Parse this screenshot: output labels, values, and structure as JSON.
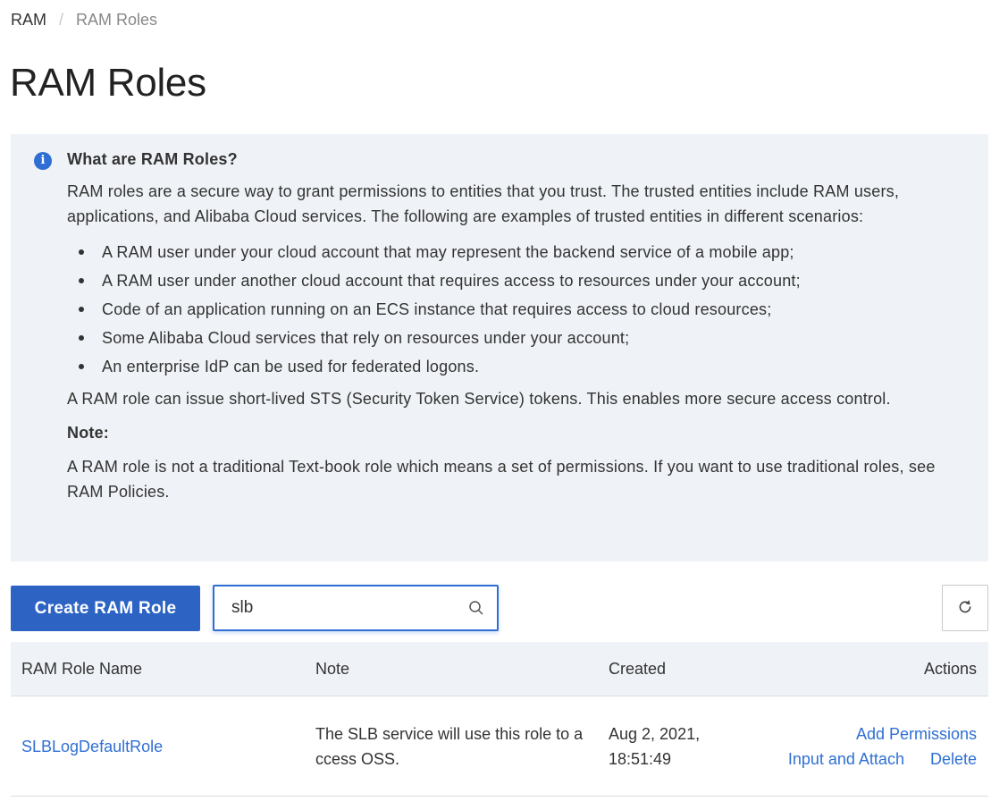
{
  "breadcrumb": {
    "root": "RAM",
    "separator": "/",
    "current": "RAM Roles"
  },
  "page_title": "RAM Roles",
  "info": {
    "heading": "What are RAM Roles?",
    "intro": "RAM roles are a secure way to grant permissions to entities that you trust. The trusted entities include RAM users, applications, and Alibaba Cloud services. The following are examples of trusted entities in different scenarios:",
    "items": [
      "A RAM user under your cloud account that may represent the backend service of a mobile app;",
      "A RAM user under another cloud account that requires access to resources under your account;",
      "Code of an application running on an ECS instance that requires access to cloud resources;",
      "Some Alibaba Cloud services that rely on resources under your account;",
      "An enterprise IdP can be used for federated logons."
    ],
    "sts_text": "A RAM role can issue short-lived STS (Security Token Service) tokens. This enables more secure access control.",
    "note_title": "Note:",
    "note_text": "A RAM role is not a traditional Text-book role which means a set of permissions. If you want to use traditional roles, see RAM Policies.",
    "icon": "info-icon",
    "accent_color": "#2f6fd3"
  },
  "toolbar": {
    "create_label": "Create RAM Role",
    "search_value": "slb",
    "search_icon": "search-icon",
    "refresh_icon": "refresh-icon",
    "primary_color": "#2d64c4"
  },
  "table": {
    "headers": {
      "name": "RAM Role Name",
      "note": "Note",
      "created": "Created",
      "actions": "Actions"
    },
    "rows": [
      {
        "name": "SLBLogDefaultRole",
        "note": "The SLB service will use this role to access OSS.",
        "created": "Aug 2, 2021, 18:51:49",
        "actions": {
          "add_permissions": "Add Permissions",
          "input_attach": "Input and Attach",
          "delete": "Delete"
        }
      }
    ]
  }
}
